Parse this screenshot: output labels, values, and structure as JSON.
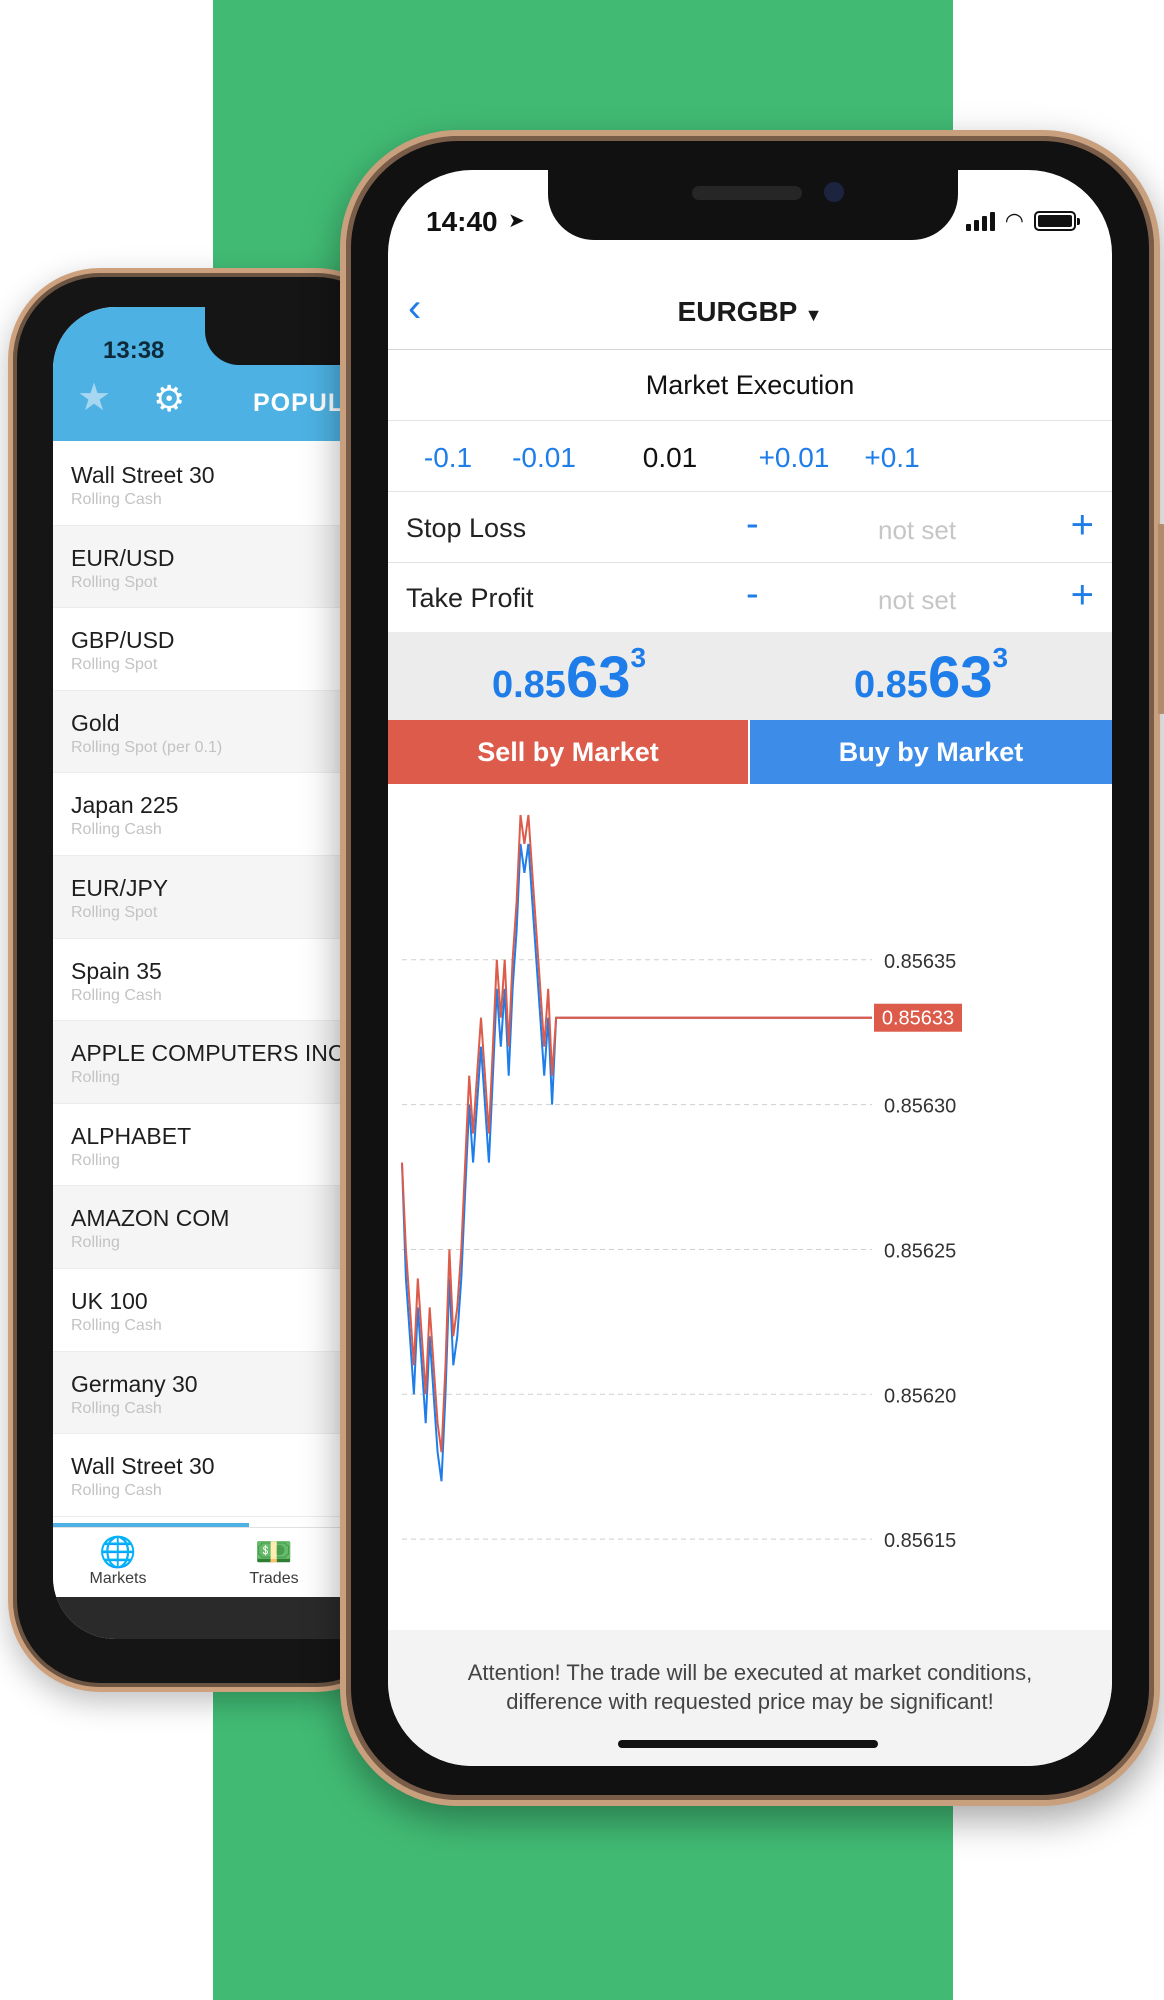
{
  "colors": {
    "background_band": "#41bb74",
    "accent_blue": "#1e7de9",
    "sell_red": "#dc5b4a",
    "buy_blue": "#3d8ce8",
    "bid_line": "#1e7de9",
    "ask_line": "#dc5b4a"
  },
  "back_phone": {
    "status_time": "13:38",
    "header_tab": "POPUL",
    "icons": [
      "star-icon",
      "gear-icon"
    ],
    "instruments": [
      {
        "name": "Wall Street 30",
        "sub": "Rolling Cash"
      },
      {
        "name": "EUR/USD",
        "sub": "Rolling Spot"
      },
      {
        "name": "GBP/USD",
        "sub": "Rolling Spot"
      },
      {
        "name": "Gold",
        "sub": "Rolling Spot (per 0.1)"
      },
      {
        "name": "Japan 225",
        "sub": "Rolling Cash"
      },
      {
        "name": "EUR/JPY",
        "sub": "Rolling Spot"
      },
      {
        "name": "Spain 35",
        "sub": "Rolling Cash"
      },
      {
        "name": "APPLE COMPUTERS INC",
        "sub": "Rolling"
      },
      {
        "name": "ALPHABET",
        "sub": "Rolling"
      },
      {
        "name": "AMAZON COM",
        "sub": "Rolling"
      },
      {
        "name": "UK 100",
        "sub": "Rolling Cash"
      },
      {
        "name": "Germany 30",
        "sub": "Rolling Cash"
      },
      {
        "name": "Wall Street 30",
        "sub": "Rolling Cash"
      }
    ],
    "tabs": [
      {
        "label": "Markets",
        "icon": "globe-icon"
      },
      {
        "label": "Trades",
        "icon": "cash-icon"
      }
    ]
  },
  "front_phone": {
    "status_time": "14:40",
    "nav_title": "EURGBP",
    "title_caret": "▼",
    "back_icon": "chevron-left-icon",
    "execution_type": "Market Execution",
    "volume": {
      "minus_large": "-0.1",
      "minus_small": "-0.01",
      "current": "0.01",
      "plus_small": "+0.01",
      "plus_large": "+0.1"
    },
    "stop_loss": {
      "label": "Stop Loss",
      "minus": "-",
      "value": "not set",
      "plus": "+"
    },
    "take_profit": {
      "label": "Take Profit",
      "minus": "-",
      "value": "not set",
      "plus": "+"
    },
    "sell_quote": {
      "prefix": "0.85",
      "big": "63",
      "small": "3"
    },
    "buy_quote": {
      "prefix": "0.85",
      "big": "63",
      "small": "3"
    },
    "sell_button": "Sell by Market",
    "buy_button": "Buy by Market",
    "attention_line1": "Attention! The trade will be executed at market conditions,",
    "attention_line2": "difference with requested price may be significant!"
  },
  "chart_data": {
    "type": "line",
    "ylim": [
      0.85612,
      0.85641
    ],
    "y_ticks": [
      "0.85635",
      "0.85630",
      "0.85625",
      "0.85620",
      "0.85615"
    ],
    "y_tick_values": [
      0.85635,
      0.8563,
      0.85625,
      0.8562,
      0.85615
    ],
    "current_price_label": "0.85633",
    "current_price": 0.85633,
    "grid": true,
    "x_count": 45,
    "series": [
      {
        "color": "#1e7de9",
        "values": [
          0.85628,
          0.85624,
          0.85622,
          0.8562,
          0.85623,
          0.85621,
          0.85619,
          0.85622,
          0.8562,
          0.85618,
          0.85617,
          0.8562,
          0.85624,
          0.85621,
          0.85622,
          0.85624,
          0.85627,
          0.8563,
          0.85628,
          0.8563,
          0.85632,
          0.8563,
          0.85628,
          0.85631,
          0.85634,
          0.85632,
          0.85634,
          0.85631,
          0.85634,
          0.85636,
          0.85639,
          0.85638,
          0.85639,
          0.85637,
          0.85635,
          0.85633,
          0.85631,
          0.85633,
          0.8563,
          0.85633,
          0.85633,
          0.85633,
          0.85633,
          0.85633,
          0.85633
        ]
      },
      {
        "color": "#dc5b4a",
        "values": [
          0.85628,
          0.85625,
          0.85623,
          0.85621,
          0.85624,
          0.85622,
          0.8562,
          0.85623,
          0.85621,
          0.85619,
          0.85618,
          0.85621,
          0.85625,
          0.85622,
          0.85623,
          0.85625,
          0.85628,
          0.85631,
          0.85629,
          0.85631,
          0.85633,
          0.85631,
          0.85629,
          0.85632,
          0.85635,
          0.85633,
          0.85635,
          0.85632,
          0.85635,
          0.85637,
          0.8564,
          0.85639,
          0.8564,
          0.85638,
          0.85636,
          0.85634,
          0.85632,
          0.85634,
          0.85631,
          0.85633,
          0.85633,
          0.85633,
          0.85633,
          0.85633,
          0.85633
        ]
      }
    ]
  }
}
